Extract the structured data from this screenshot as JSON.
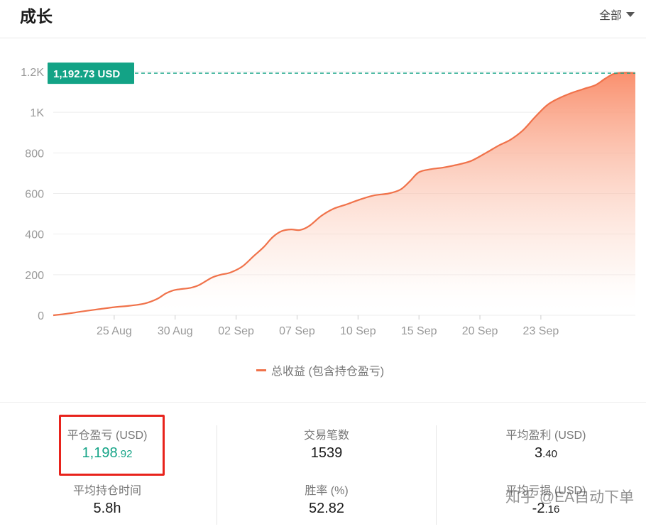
{
  "header": {
    "title": "成长",
    "range_label": "全部"
  },
  "chart_data": {
    "type": "area",
    "x_ticks": [
      "25 Aug",
      "30 Aug",
      "02 Sep",
      "07 Sep",
      "10 Sep",
      "15 Sep",
      "20 Sep",
      "23 Sep"
    ],
    "y_ticks": [
      "0",
      "200",
      "400",
      "600",
      "800",
      "1K",
      "1.2K"
    ],
    "ylim": [
      0,
      1200
    ],
    "max_label": "1,192.73 USD",
    "max_value": 1192.73,
    "legend": "总收益 (包含持仓盈亏)",
    "colors": {
      "line": "#f0724a",
      "fill_top": "#f98a66",
      "marker": "#13a386"
    },
    "series": [
      {
        "x": 0,
        "y": 0
      },
      {
        "x": 0.3,
        "y": 5
      },
      {
        "x": 0.6,
        "y": 11
      },
      {
        "x": 1.0,
        "y": 20
      },
      {
        "x": 1.5,
        "y": 30
      },
      {
        "x": 2.0,
        "y": 40
      },
      {
        "x": 2.5,
        "y": 47
      },
      {
        "x": 3.0,
        "y": 58
      },
      {
        "x": 3.4,
        "y": 80
      },
      {
        "x": 3.7,
        "y": 108
      },
      {
        "x": 4.0,
        "y": 125
      },
      {
        "x": 4.5,
        "y": 135
      },
      {
        "x": 4.8,
        "y": 150
      },
      {
        "x": 5.2,
        "y": 185
      },
      {
        "x": 5.5,
        "y": 200
      },
      {
        "x": 5.8,
        "y": 210
      },
      {
        "x": 6.2,
        "y": 240
      },
      {
        "x": 6.6,
        "y": 295
      },
      {
        "x": 6.9,
        "y": 335
      },
      {
        "x": 7.2,
        "y": 385
      },
      {
        "x": 7.5,
        "y": 415
      },
      {
        "x": 7.8,
        "y": 423
      },
      {
        "x": 8.1,
        "y": 420
      },
      {
        "x": 8.4,
        "y": 440
      },
      {
        "x": 8.8,
        "y": 490
      },
      {
        "x": 9.2,
        "y": 525
      },
      {
        "x": 9.6,
        "y": 545
      },
      {
        "x": 10.0,
        "y": 567
      },
      {
        "x": 10.5,
        "y": 590
      },
      {
        "x": 11.0,
        "y": 600
      },
      {
        "x": 11.4,
        "y": 620
      },
      {
        "x": 11.7,
        "y": 660
      },
      {
        "x": 12.0,
        "y": 705
      },
      {
        "x": 12.4,
        "y": 720
      },
      {
        "x": 12.8,
        "y": 728
      },
      {
        "x": 13.2,
        "y": 740
      },
      {
        "x": 13.7,
        "y": 760
      },
      {
        "x": 14.2,
        "y": 800
      },
      {
        "x": 14.6,
        "y": 835
      },
      {
        "x": 15.0,
        "y": 865
      },
      {
        "x": 15.4,
        "y": 910
      },
      {
        "x": 15.8,
        "y": 975
      },
      {
        "x": 16.2,
        "y": 1035
      },
      {
        "x": 16.6,
        "y": 1070
      },
      {
        "x": 17.0,
        "y": 1095
      },
      {
        "x": 17.4,
        "y": 1115
      },
      {
        "x": 17.8,
        "y": 1135
      },
      {
        "x": 18.1,
        "y": 1165
      },
      {
        "x": 18.4,
        "y": 1190
      },
      {
        "x": 18.8,
        "y": 1195
      },
      {
        "x": 19.1,
        "y": 1192.73
      }
    ],
    "x_tick_positions": [
      2,
      4,
      6,
      8,
      10,
      12,
      14,
      16,
      18
    ],
    "xlim": [
      0,
      19.1
    ]
  },
  "stats": {
    "closed_pnl": {
      "label": "平仓盈亏 (USD)",
      "int": "1,198",
      "dec": ".92"
    },
    "trade_count": {
      "label": "交易笔数",
      "value": "1539"
    },
    "avg_profit": {
      "label": "平均盈利 (USD)",
      "int": "3",
      "dec": ".40"
    },
    "avg_hold": {
      "label": "平均持仓时间",
      "value": "5.8h"
    },
    "win_rate": {
      "label": "胜率 (%)",
      "value": "52.82"
    },
    "avg_loss": {
      "label": "平均亏损 (USD)",
      "int": "-2",
      "dec": ".16"
    }
  },
  "watermark": "知乎 @EA自动下单"
}
